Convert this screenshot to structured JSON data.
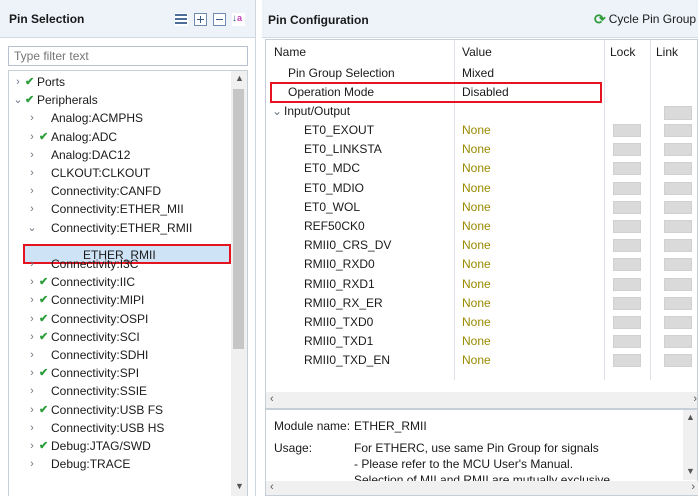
{
  "pin_selection": {
    "title": "Pin Selection",
    "tools": [
      "list-icon",
      "expand-all-icon",
      "collapse-all-icon",
      "sort-az-icon"
    ],
    "filter_placeholder": "Type filter text",
    "tree": [
      {
        "label": "Ports",
        "expander": "›",
        "checked": true
      },
      {
        "label": "Peripherals",
        "expander": "⌄",
        "checked": true
      },
      {
        "label": "Analog:ACMPHS",
        "expander": "›",
        "checked": false
      },
      {
        "label": "Analog:ADC",
        "expander": "›",
        "checked": true
      },
      {
        "label": "Analog:DAC12",
        "expander": "›",
        "checked": false
      },
      {
        "label": "CLKOUT:CLKOUT",
        "expander": "›",
        "checked": false
      },
      {
        "label": "Connectivity:CANFD",
        "expander": "›",
        "checked": false
      },
      {
        "label": "Connectivity:ETHER_MII",
        "expander": "›",
        "checked": false
      },
      {
        "label": "Connectivity:ETHER_RMII",
        "expander": "⌄",
        "checked": false
      },
      {
        "label": "ETHER_RMII",
        "expander": "",
        "checked": false
      },
      {
        "label": "Connectivity:I3C",
        "expander": "›",
        "checked": false
      },
      {
        "label": "Connectivity:IIC",
        "expander": "›",
        "checked": true
      },
      {
        "label": "Connectivity:MIPI",
        "expander": "›",
        "checked": true
      },
      {
        "label": "Connectivity:OSPI",
        "expander": "›",
        "checked": true
      },
      {
        "label": "Connectivity:SCI",
        "expander": "›",
        "checked": true
      },
      {
        "label": "Connectivity:SDHI",
        "expander": "›",
        "checked": false
      },
      {
        "label": "Connectivity:SPI",
        "expander": "›",
        "checked": true
      },
      {
        "label": "Connectivity:SSIE",
        "expander": "›",
        "checked": false
      },
      {
        "label": "Connectivity:USB FS",
        "expander": "›",
        "checked": true
      },
      {
        "label": "Connectivity:USB HS",
        "expander": "›",
        "checked": false
      },
      {
        "label": "Debug:JTAG/SWD",
        "expander": "›",
        "checked": true
      },
      {
        "label": "Debug:TRACE",
        "expander": "›",
        "checked": false
      }
    ],
    "selected_item": "ETHER_RMII"
  },
  "pin_configuration": {
    "title": "Pin Configuration",
    "cycle_button": "Cycle Pin Group",
    "columns": {
      "name": "Name",
      "value": "Value",
      "lock": "Lock",
      "link": "Link"
    },
    "rows": [
      {
        "name": "Pin Group Selection",
        "value": "Mixed"
      },
      {
        "name": "Operation Mode",
        "value": "Disabled"
      },
      {
        "name": "Input/Output",
        "value": "",
        "expander": "⌄"
      }
    ],
    "pins": [
      {
        "name": "ET0_EXOUT",
        "value": "None"
      },
      {
        "name": "ET0_LINKSTA",
        "value": "None"
      },
      {
        "name": "ET0_MDC",
        "value": "None"
      },
      {
        "name": "ET0_MDIO",
        "value": "None"
      },
      {
        "name": "ET0_WOL",
        "value": "None"
      },
      {
        "name": "REF50CK0",
        "value": "None"
      },
      {
        "name": "RMII0_CRS_DV",
        "value": "None"
      },
      {
        "name": "RMII0_RXD0",
        "value": "None"
      },
      {
        "name": "RMII0_RXD1",
        "value": "None"
      },
      {
        "name": "RMII0_RX_ER",
        "value": "None"
      },
      {
        "name": "RMII0_TXD0",
        "value": "None"
      },
      {
        "name": "RMII0_TXD1",
        "value": "None"
      },
      {
        "name": "RMII0_TXD_EN",
        "value": "None"
      }
    ]
  },
  "info": {
    "module_label": "Module name:",
    "module_value": "ETHER_RMII",
    "usage_label": "Usage:",
    "usage_lines": [
      "For ETHERC, use same Pin Group for signals",
      "- Please refer to the MCU User's Manual.",
      "Selection of MII and RMII are mutually exclusive."
    ]
  },
  "colors": {
    "accent_green": "#2b9e3b",
    "highlight_red": "#e5131f",
    "selection_blue": "#cfe3f6",
    "none_text": "#9a8a00"
  }
}
